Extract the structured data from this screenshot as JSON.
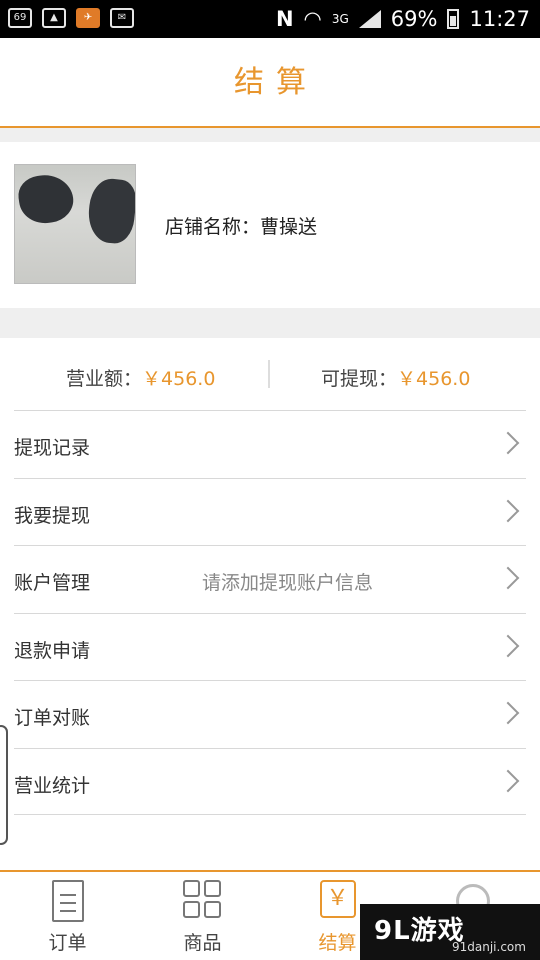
{
  "status_bar": {
    "notification_badge": "69",
    "network": "3G",
    "battery": "69%",
    "time": "11:27"
  },
  "header": {
    "title": "结算"
  },
  "store": {
    "name_text": "店铺名称：曹操送"
  },
  "stats": {
    "revenue_label": "营业额：",
    "revenue_value": "￥456.0",
    "withdrawable_label": "可提现：",
    "withdrawable_value": "￥456.0"
  },
  "menu": [
    {
      "label": "提现记录",
      "hint": ""
    },
    {
      "label": "我要提现",
      "hint": ""
    },
    {
      "label": "账户管理",
      "hint": "请添加提现账户信息"
    },
    {
      "label": "退款申请",
      "hint": ""
    },
    {
      "label": "订单对账",
      "hint": ""
    },
    {
      "label": "营业统计",
      "hint": ""
    }
  ],
  "tabbar": {
    "orders": "订单",
    "goods": "商品",
    "settle": "结算",
    "settle_icon_glyph": "￥"
  },
  "watermark": {
    "logo": "9L游戏",
    "url": "91danji.com"
  },
  "colors": {
    "accent": "#e8962e",
    "divider": "#d8d8d8",
    "background_gap": "#efefef"
  }
}
